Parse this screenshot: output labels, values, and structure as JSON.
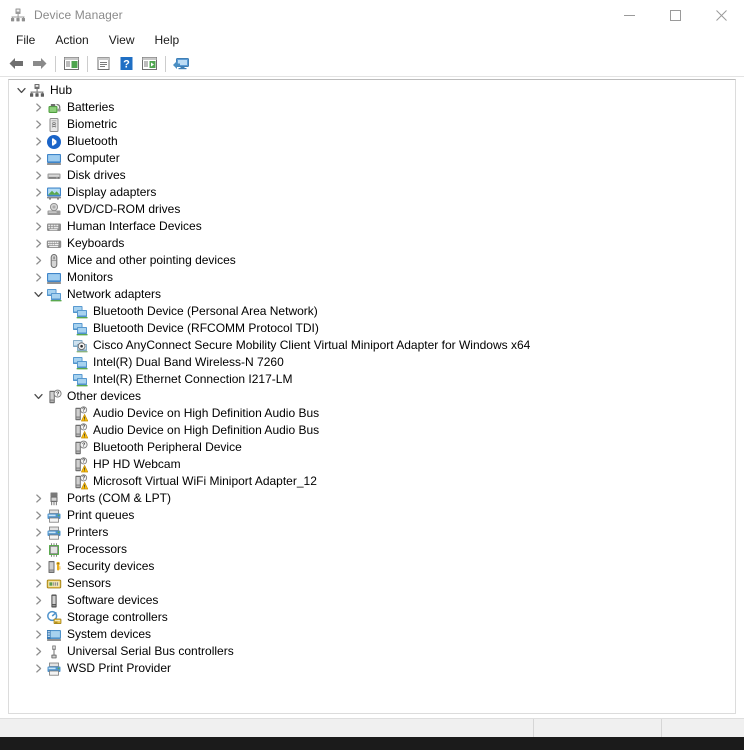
{
  "window": {
    "title": "Device Manager",
    "icon": "device-manager-icon"
  },
  "caption_buttons": [
    {
      "name": "minimize-button",
      "label": "Minimize",
      "glyph": "minimize-icon"
    },
    {
      "name": "maximize-button",
      "label": "Maximize",
      "glyph": "maximize-icon"
    },
    {
      "name": "close-button",
      "label": "Close",
      "glyph": "close-icon"
    }
  ],
  "menubar": {
    "items": [
      {
        "label": "File"
      },
      {
        "label": "Action"
      },
      {
        "label": "View"
      },
      {
        "label": "Help"
      }
    ]
  },
  "toolbar": {
    "buttons": [
      {
        "name": "back-button",
        "icon": "back-arrow-icon"
      },
      {
        "name": "forward-button",
        "icon": "forward-arrow-icon"
      },
      {
        "separator_after": true
      },
      {
        "name": "show-hide-console-tree-button",
        "icon": "console-tree-icon"
      },
      {
        "separator_after": true
      },
      {
        "name": "properties-button",
        "icon": "properties-icon"
      },
      {
        "separator_after": false
      },
      {
        "name": "help-button",
        "icon": "help-question-icon"
      },
      {
        "name": "update-driver-button",
        "icon": "update-driver-icon"
      },
      {
        "separator_after": true
      },
      {
        "name": "scan-for-hardware-changes-button",
        "icon": "scan-hardware-icon"
      }
    ]
  },
  "tree": {
    "nodes": [
      {
        "level": 0,
        "label": "Hub",
        "icon": "hub-icon",
        "state": "expanded"
      },
      {
        "level": 1,
        "label": "Batteries",
        "icon": "battery-icon",
        "state": "collapsed"
      },
      {
        "level": 1,
        "label": "Biometric",
        "icon": "biometric-icon",
        "state": "collapsed"
      },
      {
        "level": 1,
        "label": "Bluetooth",
        "icon": "bluetooth-icon",
        "state": "collapsed"
      },
      {
        "level": 1,
        "label": "Computer",
        "icon": "computer-icon",
        "state": "collapsed"
      },
      {
        "level": 1,
        "label": "Disk drives",
        "icon": "disk-drive-icon",
        "state": "collapsed"
      },
      {
        "level": 1,
        "label": "Display adapters",
        "icon": "display-adapter-icon",
        "state": "collapsed"
      },
      {
        "level": 1,
        "label": "DVD/CD-ROM drives",
        "icon": "dvd-drive-icon",
        "state": "collapsed"
      },
      {
        "level": 1,
        "label": "Human Interface Devices",
        "icon": "hid-icon",
        "state": "collapsed"
      },
      {
        "level": 1,
        "label": "Keyboards",
        "icon": "keyboard-icon",
        "state": "collapsed"
      },
      {
        "level": 1,
        "label": "Mice and other pointing devices",
        "icon": "mouse-icon",
        "state": "collapsed"
      },
      {
        "level": 1,
        "label": "Monitors",
        "icon": "monitor-icon",
        "state": "collapsed"
      },
      {
        "level": 1,
        "label": "Network adapters",
        "icon": "network-adapter-icon",
        "state": "expanded"
      },
      {
        "level": 2,
        "label": "Bluetooth Device (Personal Area Network)",
        "icon": "network-adapter-icon",
        "state": "leaf"
      },
      {
        "level": 2,
        "label": "Bluetooth Device (RFCOMM Protocol TDI)",
        "icon": "network-adapter-icon",
        "state": "leaf"
      },
      {
        "level": 2,
        "label": "Cisco AnyConnect Secure Mobility Client Virtual Miniport Adapter for Windows x64",
        "icon": "network-adapter-disabled-icon",
        "state": "leaf"
      },
      {
        "level": 2,
        "label": "Intel(R) Dual Band Wireless-N 7260",
        "icon": "network-adapter-icon",
        "state": "leaf"
      },
      {
        "level": 2,
        "label": "Intel(R) Ethernet Connection I217-LM",
        "icon": "network-adapter-icon",
        "state": "leaf"
      },
      {
        "level": 1,
        "label": "Other devices",
        "icon": "unknown-device-icon",
        "state": "expanded"
      },
      {
        "level": 2,
        "label": "Audio Device on High Definition Audio Bus",
        "icon": "unknown-device-warning-icon",
        "state": "leaf"
      },
      {
        "level": 2,
        "label": "Audio Device on High Definition Audio Bus",
        "icon": "unknown-device-warning-icon",
        "state": "leaf"
      },
      {
        "level": 2,
        "label": "Bluetooth Peripheral Device",
        "icon": "unknown-device-icon",
        "state": "leaf"
      },
      {
        "level": 2,
        "label": "HP HD Webcam",
        "icon": "unknown-device-warning-icon",
        "state": "leaf"
      },
      {
        "level": 2,
        "label": "Microsoft Virtual WiFi Miniport Adapter_12",
        "icon": "unknown-device-warning-icon",
        "state": "leaf"
      },
      {
        "level": 1,
        "label": "Ports (COM & LPT)",
        "icon": "port-icon",
        "state": "collapsed"
      },
      {
        "level": 1,
        "label": "Print queues",
        "icon": "printer-icon",
        "state": "collapsed"
      },
      {
        "level": 1,
        "label": "Printers",
        "icon": "printer-icon",
        "state": "collapsed"
      },
      {
        "level": 1,
        "label": "Processors",
        "icon": "processor-icon",
        "state": "collapsed"
      },
      {
        "level": 1,
        "label": "Security devices",
        "icon": "security-device-icon",
        "state": "collapsed"
      },
      {
        "level": 1,
        "label": "Sensors",
        "icon": "sensor-icon",
        "state": "collapsed"
      },
      {
        "level": 1,
        "label": "Software devices",
        "icon": "software-device-icon",
        "state": "collapsed"
      },
      {
        "level": 1,
        "label": "Storage controllers",
        "icon": "storage-controller-icon",
        "state": "collapsed"
      },
      {
        "level": 1,
        "label": "System devices",
        "icon": "system-device-icon",
        "state": "collapsed"
      },
      {
        "level": 1,
        "label": "Universal Serial Bus controllers",
        "icon": "usb-controller-icon",
        "state": "collapsed"
      },
      {
        "level": 1,
        "label": "WSD Print Provider",
        "icon": "printer-icon",
        "state": "collapsed"
      }
    ]
  },
  "statusbar": {
    "main_text": "",
    "pane2_text": "",
    "pane3_text": ""
  },
  "colors": {
    "title_text": "#8a8a8a",
    "window_bg": "#ffffff",
    "statusbar_bg": "#f0f0f0",
    "warning_yellow": "#ffc20e",
    "accent_blue": "#1a7fd4",
    "network_green": "#7cb342"
  }
}
